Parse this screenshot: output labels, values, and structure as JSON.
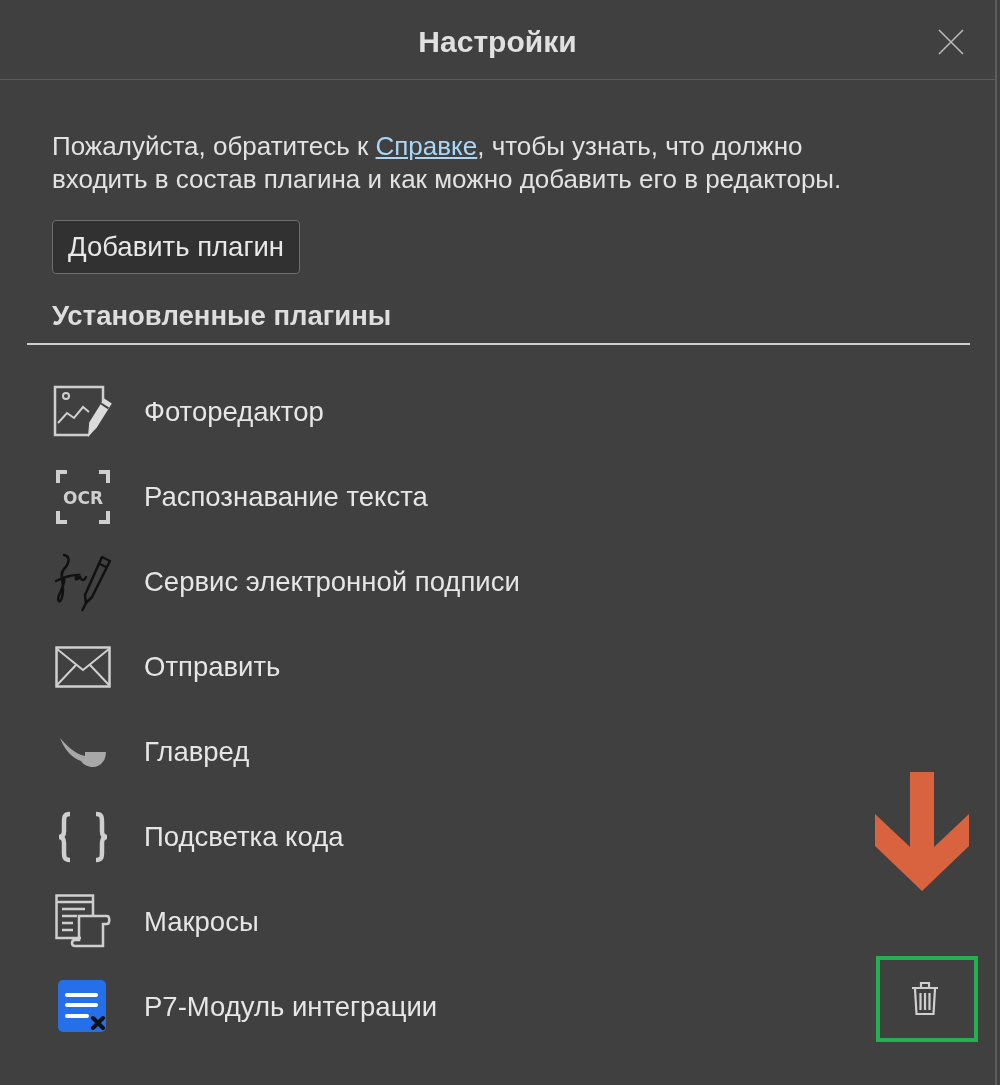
{
  "dialog": {
    "title": "Настройки"
  },
  "intro": {
    "before": "Пожалуйста, обратитесь к ",
    "link": "Справке",
    "after": ", чтобы узнать, что должно входить в состав плагина и как можно добавить его в редакторы."
  },
  "add_button": {
    "label": "Добавить плагин"
  },
  "installed": {
    "heading": "Установленные плагины",
    "plugins": [
      {
        "name": "Фоторедактор",
        "kind": "photo",
        "show_delete": false
      },
      {
        "name": "Распознавание текста",
        "kind": "ocr",
        "icon_label": "OCR",
        "show_delete": false
      },
      {
        "name": "Сервис электронной подписи",
        "kind": "signature",
        "show_delete": false
      },
      {
        "name": "Отправить",
        "kind": "mail",
        "show_delete": false
      },
      {
        "name": "Главред",
        "kind": "pipe",
        "show_delete": false
      },
      {
        "name": "Подсветка кода",
        "kind": "braces",
        "show_delete": false
      },
      {
        "name": "Макросы",
        "kind": "macros",
        "show_delete": false
      },
      {
        "name": "Р7-Модуль интеграции",
        "kind": "document",
        "show_delete": true
      }
    ]
  },
  "annotations": [
    {
      "kind": "arrow",
      "color": "#d9623f"
    },
    {
      "kind": "frame",
      "color": "#22b14c"
    }
  ]
}
